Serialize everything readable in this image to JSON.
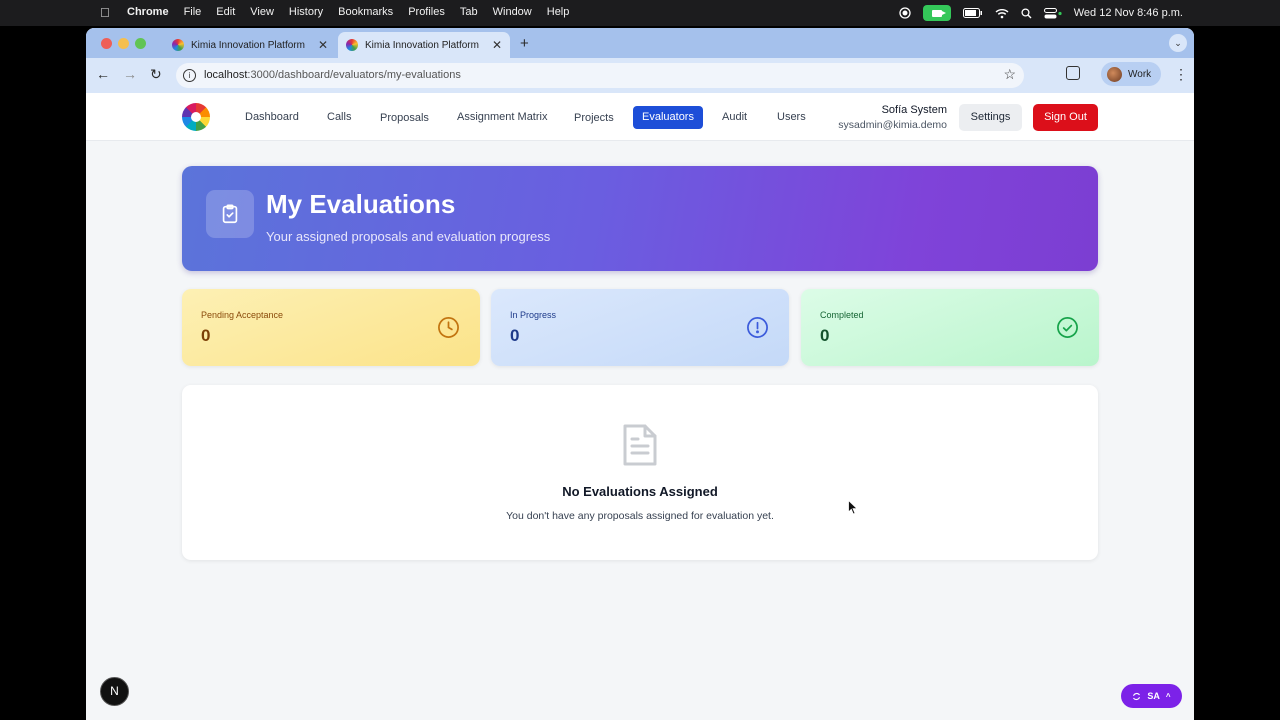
{
  "menubar": {
    "app": "Chrome",
    "items": [
      "File",
      "Edit",
      "View",
      "History",
      "Bookmarks",
      "Profiles",
      "Tab",
      "Window",
      "Help"
    ],
    "clock": "Wed 12 Nov  8:46 p.m."
  },
  "browser": {
    "tabs": [
      {
        "title": "Kimia Innovation Platform",
        "active": false
      },
      {
        "title": "Kimia Innovation Platform",
        "active": true
      }
    ],
    "url_host": "localhost",
    "url_path": ":3000/dashboard/evaluators/my-evaluations",
    "profile": "Work"
  },
  "nav": {
    "links": [
      "Dashboard",
      "Calls",
      "Proposals",
      "Assignment Matrix",
      "Projects",
      "Evaluators",
      "Audit",
      "Users"
    ],
    "active": "Evaluators",
    "user_name": "Sofía System",
    "user_email": "sysadmin@kimia.demo",
    "settings": "Settings",
    "signout": "Sign Out"
  },
  "hero": {
    "title": "My Evaluations",
    "subtitle": "Your assigned proposals and evaluation progress",
    "icon": "clipboard-check-icon"
  },
  "stats": [
    {
      "label": "Pending Acceptance",
      "value": "0",
      "icon": "clock-icon",
      "color": "#c2740f"
    },
    {
      "label": "In Progress",
      "value": "0",
      "icon": "alert-circle-icon",
      "color": "#3b5bdb"
    },
    {
      "label": "Completed",
      "value": "0",
      "icon": "check-circle-icon",
      "color": "#16a34a"
    }
  ],
  "empty": {
    "title": "No Evaluations Assigned",
    "message": "You don't have any proposals assigned for evaluation yet.",
    "icon": "document-icon"
  },
  "badges": {
    "dev": "N",
    "session": "SA"
  },
  "colors": {
    "primary": "#1d4ed8",
    "danger": "#dc0f1a",
    "accent": "#7c22e8"
  }
}
